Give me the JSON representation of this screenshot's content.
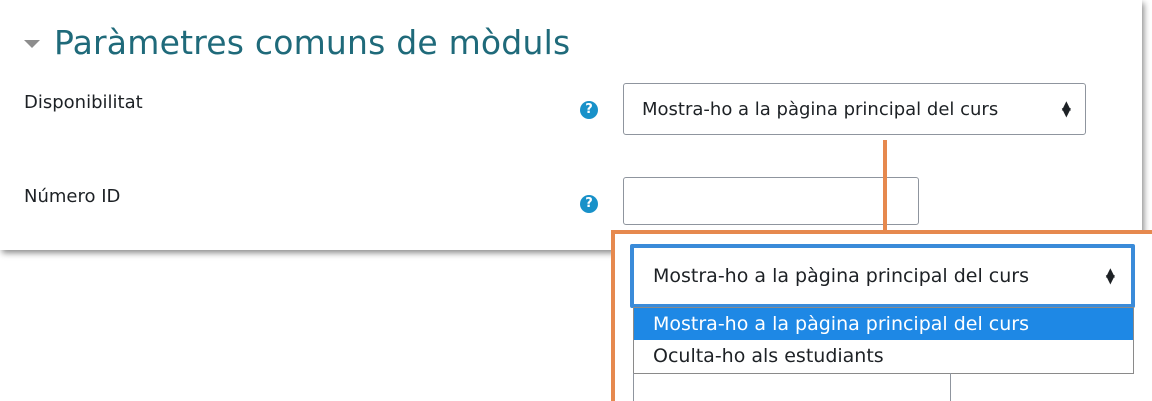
{
  "section": {
    "title": "Paràmetres comuns de mòduls",
    "collapse_icon": "caret-down-icon"
  },
  "fields": {
    "availability": {
      "label": "Disponibilitat",
      "help_icon": "question-circle-icon",
      "help_glyph": "?",
      "selected_value": "Mostra-ho a la pàgina principal del curs"
    },
    "id_number": {
      "label": "Número ID",
      "help_icon": "question-circle-icon",
      "help_glyph": "?",
      "value": ""
    }
  },
  "zoom": {
    "selected_value": "Mostra-ho a la pàgina principal del curs",
    "options": [
      "Mostra-ho a la pàgina principal del curs",
      "Oculta-ho als estudiants"
    ],
    "highlight_color": "#1e88e5",
    "callout_color": "#e6894e"
  },
  "colors": {
    "title": "#1f6a7a",
    "help_icon": "#1891c9",
    "focus_border": "#3a8bd9"
  }
}
